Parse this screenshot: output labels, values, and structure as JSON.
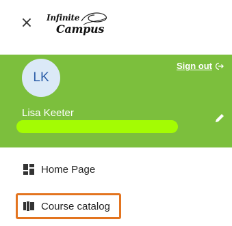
{
  "header": {
    "close_glyph": "×",
    "logo": {
      "line1": "Infinite",
      "line2": "Campus"
    }
  },
  "profile": {
    "initials": "LK",
    "name": "Lisa Keeter",
    "sign_out_label": "Sign out",
    "background": "#7cbf3d"
  },
  "menu": {
    "items": [
      {
        "label": "Home Page",
        "icon": "home-grid-icon"
      },
      {
        "label": "Course catalog",
        "icon": "book-catalog-icon"
      }
    ],
    "highlight_color": "#e3741f"
  }
}
